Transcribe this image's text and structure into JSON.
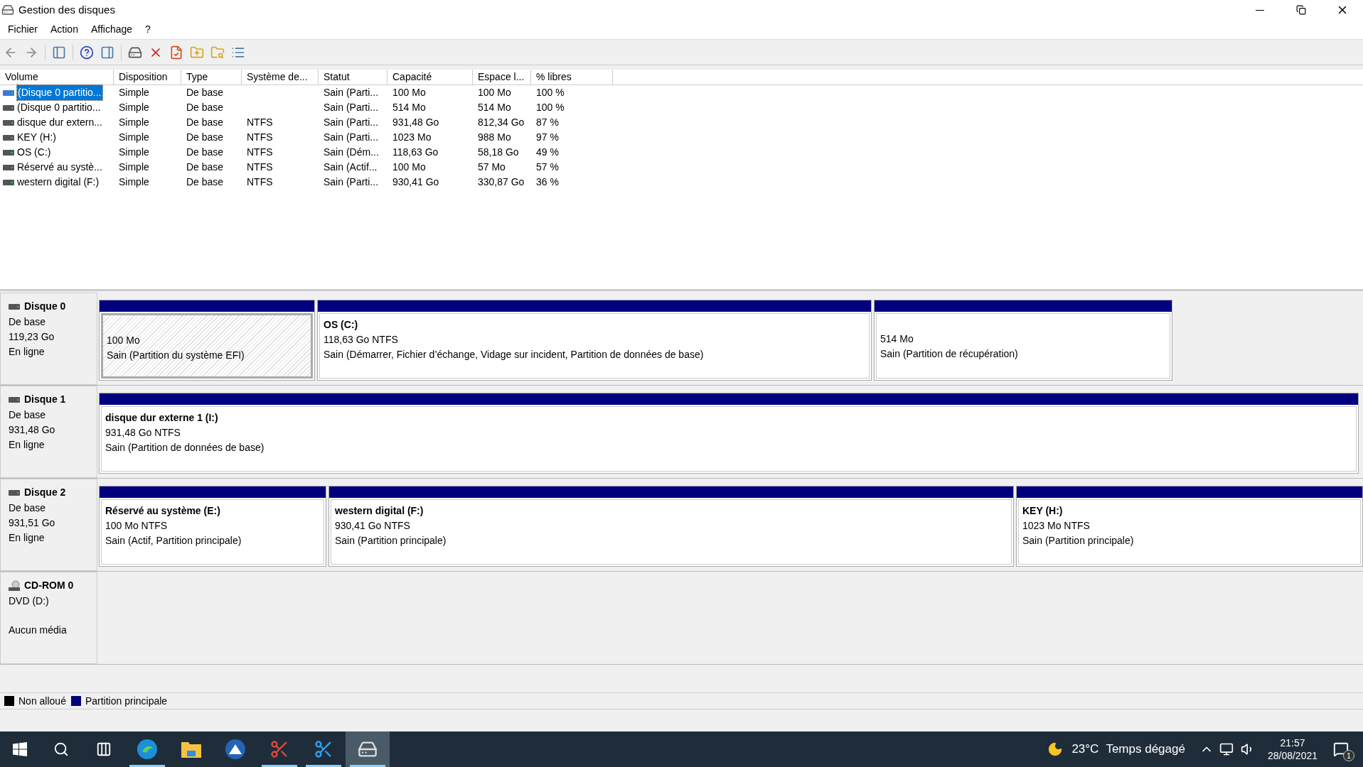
{
  "window": {
    "title": "Gestion des disques"
  },
  "menu": [
    "Fichier",
    "Action",
    "Affichage",
    "?"
  ],
  "table": {
    "columns": [
      "Volume",
      "Disposition",
      "Type",
      "Système de...",
      "Statut",
      "Capacité",
      "Espace l...",
      "% libres"
    ],
    "rows": [
      {
        "selected": true,
        "cells": [
          "(Disque 0 partitio...",
          "Simple",
          "De base",
          "",
          "Sain (Parti...",
          "100 Mo",
          "100 Mo",
          "100 %"
        ]
      },
      {
        "selected": false,
        "cells": [
          "(Disque 0 partitio...",
          "Simple",
          "De base",
          "",
          "Sain (Parti...",
          "514 Mo",
          "514 Mo",
          "100 %"
        ]
      },
      {
        "selected": false,
        "cells": [
          "disque dur extern...",
          "Simple",
          "De base",
          "NTFS",
          "Sain (Parti...",
          "931,48 Go",
          "812,34 Go",
          "87 %"
        ]
      },
      {
        "selected": false,
        "cells": [
          "KEY (H:)",
          "Simple",
          "De base",
          "NTFS",
          "Sain (Parti...",
          "1023 Mo",
          "988 Mo",
          "97 %"
        ]
      },
      {
        "selected": false,
        "cells": [
          "OS (C:)",
          "Simple",
          "De base",
          "NTFS",
          "Sain (Dém...",
          "118,63 Go",
          "58,18 Go",
          "49 %"
        ]
      },
      {
        "selected": false,
        "cells": [
          "Réservé au systè...",
          "Simple",
          "De base",
          "NTFS",
          "Sain (Actif...",
          "100 Mo",
          "57 Mo",
          "57 %"
        ]
      },
      {
        "selected": false,
        "cells": [
          "western digital (F:)",
          "Simple",
          "De base",
          "NTFS",
          "Sain (Parti...",
          "930,41 Go",
          "330,87 Go",
          "36 %"
        ]
      }
    ]
  },
  "disks": [
    {
      "kind": "disk",
      "name": "Disque 0",
      "type": "De base",
      "size": "119,23 Go",
      "status": "En ligne",
      "partitions": [
        {
          "selected": true,
          "size": "100 Mo",
          "status": "Sain (Partition du système EFI)"
        },
        {
          "selected": false,
          "name": "OS  (C:)",
          "size": "118,63 Go NTFS",
          "status": "Sain (Démarrer, Fichier d’échange, Vidage sur incident, Partition de données de base)"
        },
        {
          "selected": false,
          "size": "514 Mo",
          "status": "Sain (Partition de récupération)"
        }
      ]
    },
    {
      "kind": "disk",
      "name": "Disque 1",
      "type": "De base",
      "size": "931,48 Go",
      "status": "En ligne",
      "partitions": [
        {
          "selected": false,
          "name": "disque dur externe 1  (I:)",
          "size": "931,48 Go NTFS",
          "status": "Sain (Partition de données de base)"
        }
      ]
    },
    {
      "kind": "disk",
      "name": "Disque 2",
      "type": "De base",
      "size": "931,51 Go",
      "status": "En ligne",
      "partitions": [
        {
          "selected": false,
          "name": "Réservé au système  (E:)",
          "size": "100 Mo NTFS",
          "status": "Sain (Actif, Partition principale)"
        },
        {
          "selected": false,
          "name": "western digital  (F:)",
          "size": "930,41 Go NTFS",
          "status": "Sain (Partition principale)"
        },
        {
          "selected": false,
          "name": "KEY  (H:)",
          "size": "1023 Mo NTFS",
          "status": "Sain (Partition principale)"
        }
      ]
    },
    {
      "kind": "cdrom",
      "name": "CD-ROM 0",
      "type": "DVD (D:)",
      "status": "Aucun média"
    }
  ],
  "legend": [
    {
      "label": "Non alloué",
      "color": "#000000"
    },
    {
      "label": "Partition principale",
      "color": "#00007f"
    }
  ],
  "taskbar": {
    "apps": [
      {
        "kind": "edge",
        "running": true,
        "selected": false
      },
      {
        "kind": "folder",
        "running": false,
        "selected": false
      },
      {
        "kind": "vpn",
        "running": false,
        "selected": false
      },
      {
        "kind": "snip",
        "running": true,
        "selected": false
      },
      {
        "kind": "snip2",
        "running": true,
        "selected": false
      },
      {
        "kind": "disk",
        "running": true,
        "selected": true
      }
    ],
    "temperature": "23°C",
    "weather": "Temps dégagé",
    "time": "21:57",
    "date": "28/08/2021",
    "notifications": "1"
  }
}
